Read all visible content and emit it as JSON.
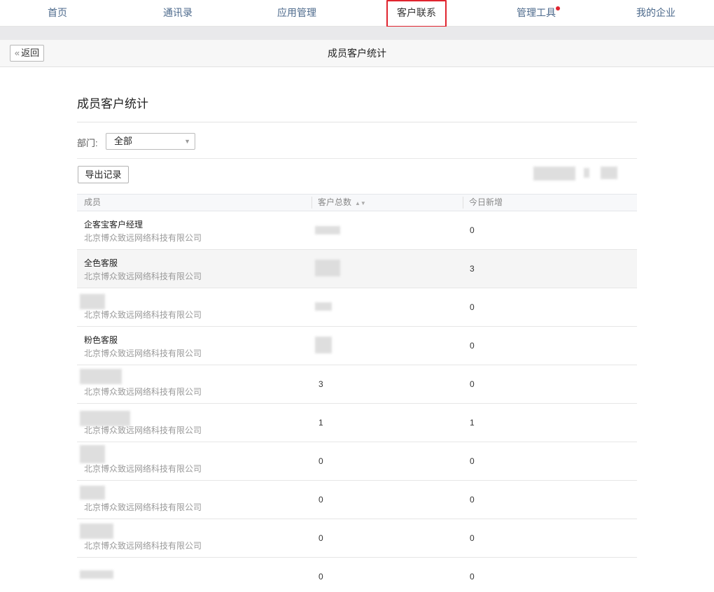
{
  "nav": {
    "items": [
      {
        "label": "首页"
      },
      {
        "label": "通讯录"
      },
      {
        "label": "应用管理"
      },
      {
        "label": "客户联系",
        "active": true
      },
      {
        "label": "管理工具",
        "badge": true
      },
      {
        "label": "我的企业"
      }
    ]
  },
  "subbar": {
    "back_label": "返回",
    "title": "成员客户统计"
  },
  "page": {
    "title": "成员客户统计",
    "dept_label": "部门:",
    "dept_value": "全部",
    "export_label": "导出记录"
  },
  "table": {
    "headers": {
      "member": "成员",
      "total": "客户总数",
      "today": "今日新增"
    },
    "rows": [
      {
        "name": "企客宝客户经理",
        "org": "北京博众致远网络科技有限公司",
        "total": "",
        "today": "0"
      },
      {
        "name": "全色客服",
        "org": "北京博众致远网络科技有限公司",
        "total": "",
        "today": "3"
      },
      {
        "name": "",
        "org": "北京博众致远网络科技有限公司",
        "total": "",
        "today": "0"
      },
      {
        "name": "粉色客服",
        "org": "北京博众致远网络科技有限公司",
        "total": "",
        "today": "0"
      },
      {
        "name": "",
        "org": "北京博众致远网络科技有限公司",
        "total": "3",
        "today": "0"
      },
      {
        "name": "",
        "org": "北京博众致远网络科技有限公司",
        "total": "1",
        "today": "1"
      },
      {
        "name": "",
        "org": "北京博众致远网络科技有限公司",
        "total": "0",
        "today": "0"
      },
      {
        "name": "",
        "org": "北京博众致远网络科技有限公司",
        "total": "0",
        "today": "0"
      },
      {
        "name": "",
        "org": "北京博众致远网络科技有限公司",
        "total": "0",
        "today": "0"
      },
      {
        "name": "",
        "org": "",
        "total": "0",
        "today": "0"
      }
    ]
  },
  "colors": {
    "accent_red": "#e0242f",
    "nav_text": "#4d6a8c",
    "muted": "#9a9a9a"
  }
}
